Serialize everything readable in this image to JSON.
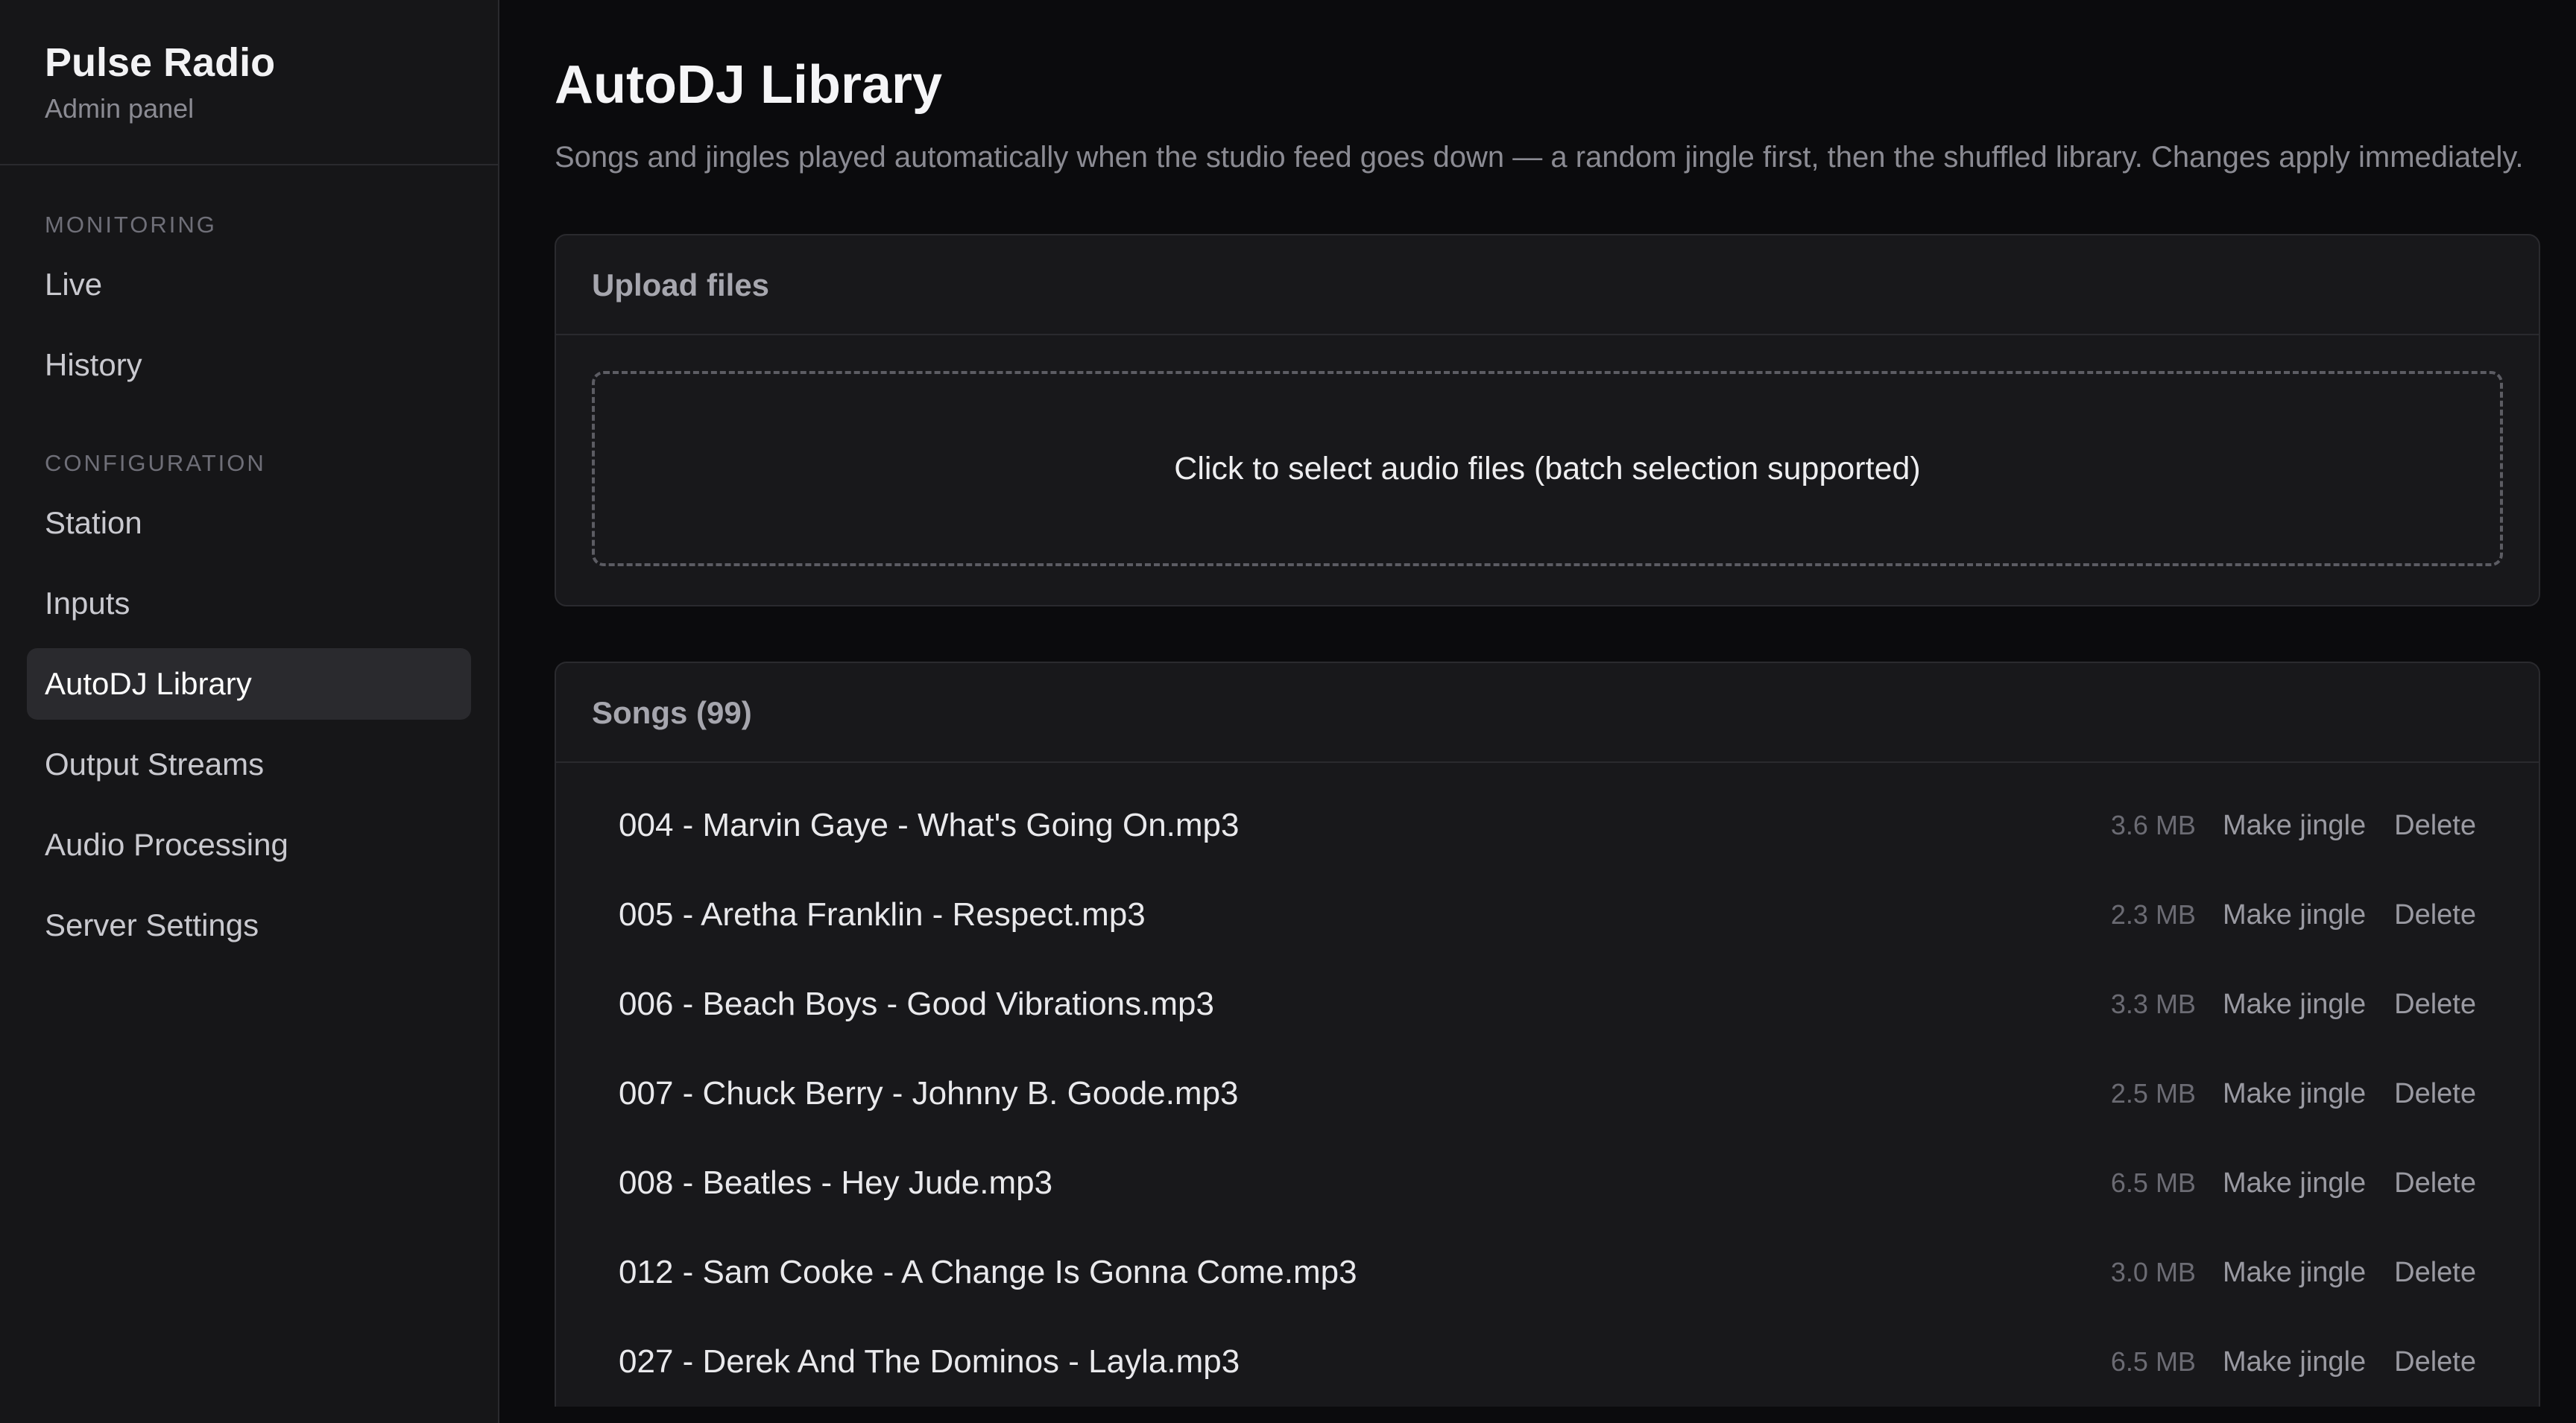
{
  "sidebar": {
    "brand_title": "Pulse Radio",
    "brand_subtitle": "Admin panel",
    "sections": [
      {
        "label": "MONITORING",
        "items": [
          {
            "label": "Live"
          },
          {
            "label": "History"
          }
        ]
      },
      {
        "label": "CONFIGURATION",
        "items": [
          {
            "label": "Station"
          },
          {
            "label": "Inputs"
          },
          {
            "label": "AutoDJ Library",
            "active": true
          },
          {
            "label": "Output Streams"
          },
          {
            "label": "Audio Processing"
          },
          {
            "label": "Server Settings"
          }
        ]
      }
    ]
  },
  "main": {
    "title": "AutoDJ Library",
    "description": "Songs and jingles played automatically when the studio feed goes down — a random jingle first, then the shuffled library. Changes apply immediately.",
    "upload": {
      "header": "Upload files",
      "dropzone_text": "Click to select audio files (batch selection supported)"
    },
    "songs": {
      "header": "Songs (99)",
      "make_jingle_label": "Make jingle",
      "delete_label": "Delete",
      "items": [
        {
          "name": "004 - Marvin Gaye - What's Going On.mp3",
          "size": "3.6 MB"
        },
        {
          "name": "005 - Aretha Franklin - Respect.mp3",
          "size": "2.3 MB"
        },
        {
          "name": "006 - Beach Boys - Good Vibrations.mp3",
          "size": "3.3 MB"
        },
        {
          "name": "007 - Chuck Berry - Johnny B. Goode.mp3",
          "size": "2.5 MB"
        },
        {
          "name": "008 - Beatles - Hey Jude.mp3",
          "size": "6.5 MB"
        },
        {
          "name": "012 - Sam Cooke - A Change Is Gonna Come.mp3",
          "size": "3.0 MB"
        },
        {
          "name": "027 - Derek And The Dominos - Layla.mp3",
          "size": "6.5 MB"
        }
      ]
    }
  },
  "colors": {
    "background": "#0b0b0d",
    "sidebar": "#161618",
    "card": "#18181b",
    "active_item": "#2a2a2e"
  }
}
